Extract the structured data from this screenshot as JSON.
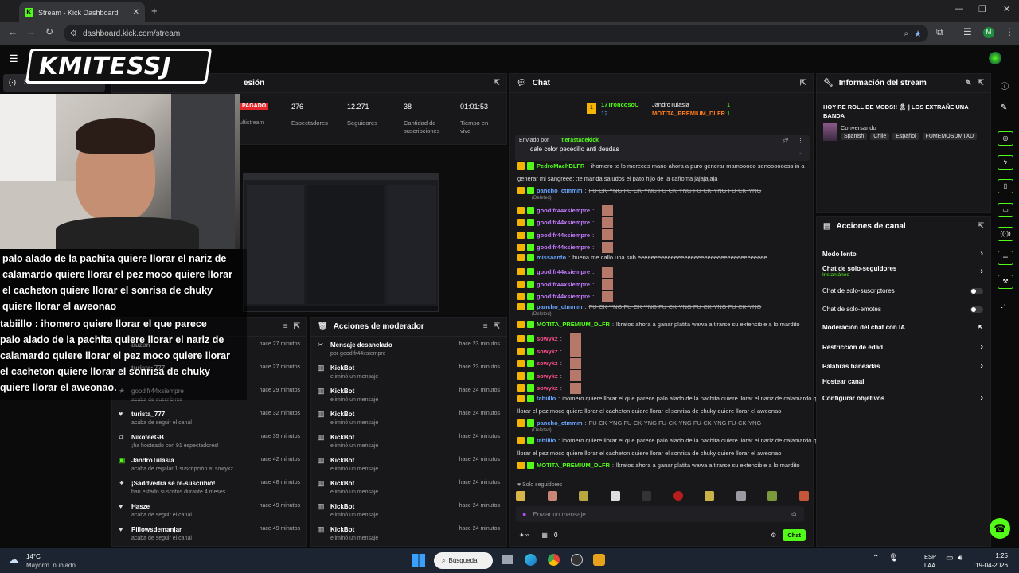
{
  "browser": {
    "tab_title": "Stream - Kick Dashboard",
    "url": "dashboard.kick.com/stream",
    "profile": "M"
  },
  "logo": "KMITESSJ",
  "session": {
    "title_partial": "esión",
    "tab_partial": "Str",
    "badge": "PAGADO",
    "multistream": "ultistream",
    "stats": [
      {
        "value": "276",
        "label": "Espectadores"
      },
      {
        "value": "12.271",
        "label": "Seguidores"
      },
      {
        "value": "38",
        "label": "Cantidad de suscripciones"
      },
      {
        "value": "01:01:53",
        "label": "Tiempo en vivo"
      }
    ]
  },
  "overlay_lines": [
    "palo alado de la pachita quiere llorar el nariz de",
    "calamardo quiere llorar el pez moco quiere llorar",
    "el cacheton quiere llorar el sonrisa de chuky",
    "quiere llorar el aweonao",
    "tabiillo : ihomero quiere llorar el que parece",
    "palo alado de la pachita quiere llorar el nariz de",
    "calamardo quiere llorar el pez moco quiere llorar",
    "el cacheton quiere llorar el sonrisa de chuky",
    "quiere llorar el aweonao."
  ],
  "activity": {
    "items": [
      {
        "name": "buzon",
        "desc": "",
        "time": "hace 27 minutos"
      },
      {
        "name": "turista_777",
        "desc": "",
        "time": "hace 27 minutos"
      },
      {
        "name": "goodlfr44xsiempre",
        "desc": "acaba de suscribirse",
        "time": "hace 29 minutos"
      },
      {
        "name": "turista_777",
        "desc": "acaba de seguir el canal",
        "time": "hace 32 minutos"
      },
      {
        "name": "NikoteeGB",
        "desc": "¡ha hosteado con 91 espectadores!",
        "time": "hace 35 minutos"
      },
      {
        "name": "JandroTulasia",
        "desc": "acaba de regalar 1 suscripción a: sowykz",
        "time": "hace 42 minutos"
      },
      {
        "name": "¡Saddvedra se re-suscribió!",
        "desc": "han estado suscritos durante 4 meses",
        "time": "hace 48 minutos"
      },
      {
        "name": "Hasze",
        "desc": "acaba de seguir el canal",
        "time": "hace 49 minutos"
      },
      {
        "name": "Pillowsdemanjar",
        "desc": "acaba de seguir el canal",
        "time": "hace 49 minutos"
      }
    ]
  },
  "mod": {
    "title": "Acciones de moderador",
    "items": [
      {
        "name": "Mensaje desanclado",
        "desc": "por goodlfr44xsiempre",
        "time": "hace 23 minutos"
      },
      {
        "name": "KickBot",
        "desc": "eliminó un mensaje",
        "time": "hace 23 minutos"
      },
      {
        "name": "KickBot",
        "desc": "eliminó un mensaje",
        "time": "hace 24 minutos"
      },
      {
        "name": "KickBot",
        "desc": "eliminó un mensaje",
        "time": "hace 24 minutos"
      },
      {
        "name": "KickBot",
        "desc": "eliminó un mensaje",
        "time": "hace 24 minutos"
      },
      {
        "name": "KickBot",
        "desc": "eliminó un mensaje",
        "time": "hace 24 minutos"
      },
      {
        "name": "KickBot",
        "desc": "eliminó un mensaje",
        "time": "hace 24 minutos"
      },
      {
        "name": "KickBot",
        "desc": "eliminó un mensaje",
        "time": "hace 24 minutos"
      },
      {
        "name": "KickBot",
        "desc": "eliminó un mensaje",
        "time": "hace 24 minutos"
      }
    ]
  },
  "chat": {
    "title": "Chat",
    "top_gifter_1": "17TroncosoC",
    "top_gifter_1_count": "12",
    "top_gifter_2": "JandroTulasia",
    "top_gifter_2_count": "1",
    "top_gifter_3": "MOTITA_PREMIUM_DLFR",
    "top_gifter_3_count": "1",
    "pinned_by_label": "Enviado por",
    "pinned_by": "tierastadekick",
    "pinned_text": "dale color pececillo anti deudas",
    "msgs": [
      {
        "user": "PedroMachDLFR",
        "text": "ihomero te lo mereces mano ahora a puro generar mamooooo senooooooss in a",
        "cls": "user-g"
      },
      {
        "user": "",
        "text": "generar mi sangreee: :te manda saludos el pato hijo de la cañoma jajajajaja",
        "cls": ""
      },
      {
        "user": "pancho_ctmmm",
        "text": "FU-CK-YNG  FU-CK-YNG  FU-CK-YNG  FU-CK-YNG  FU-CK-YNG",
        "cls": "user-b",
        "strike": true,
        "deleted": "(Deleted)"
      },
      {
        "user": "goodlfr44xsiempre",
        "text": "",
        "cls": "user-p"
      },
      {
        "user": "goodlfr44xsiempre",
        "text": "",
        "cls": "user-p"
      },
      {
        "user": "goodlfr44xsiempre",
        "text": "",
        "cls": "user-p"
      },
      {
        "user": "goodlfr44xsiempre",
        "text": "",
        "cls": "user-p"
      },
      {
        "user": "missaanto",
        "text": "buena me callo una sub eeeeeeeeeeeeeeeeeeeeeeeeeeeeeeeeeeeeeee",
        "cls": "user-b"
      },
      {
        "user": "goodlfr44xsiempre",
        "text": "",
        "cls": "user-p"
      },
      {
        "user": "goodlfr44xsiempre",
        "text": "",
        "cls": "user-p"
      },
      {
        "user": "goodlfr44xsiempre",
        "text": "",
        "cls": "user-p"
      },
      {
        "user": "pancho_ctmmm",
        "text": "FU-CK-YNG  FU-CK-YNG  FU-CK-YNG  FU-CK-YNG  FU-CK-YNG",
        "cls": "user-b",
        "strike": true,
        "deleted": "(Deleted)"
      },
      {
        "user": "MOTITA_PREMIUM_DLFR",
        "text": "lkratos ahora a ganar platita wawa a tirarse su extencible a lo mardito",
        "cls": "user-g"
      },
      {
        "user": "sowykz",
        "text": "",
        "cls": "user-r"
      },
      {
        "user": "sowykz",
        "text": "",
        "cls": "user-r"
      },
      {
        "user": "sowykz",
        "text": "",
        "cls": "user-r"
      },
      {
        "user": "sowykz",
        "text": "",
        "cls": "user-r"
      },
      {
        "user": "sowykz",
        "text": "",
        "cls": "user-r"
      },
      {
        "user": "tabiillo",
        "text": "ihomero quiere llorar el que parece palo alado de la pachita quiere llorar el nariz de calamardo quiere",
        "cls": "user-b"
      },
      {
        "user": "",
        "text": "llorar el pez moco quiere llorar el cacheton quiere llorar el sonrisa de chuky quiere llorar el aweonao",
        "cls": ""
      },
      {
        "user": "pancho_ctmmm",
        "text": "FU-CK-YNG  FU-CK-YNG  FU-CK-YNG  FU-CK-YNG  FU-CK-YNG",
        "cls": "user-b",
        "strike": true,
        "deleted": "(Deleted)"
      },
      {
        "user": "tabiillo",
        "text": "ihomero quiere llorar el que parece palo alado de la pachita quiere llorar el nariz de calamardo quiere",
        "cls": "user-b"
      },
      {
        "user": "",
        "text": "llorar el pez moco quiere llorar el cacheton quiere llorar el sonrisa de chuky quiere llorar el aweonao",
        "cls": ""
      },
      {
        "user": "MOTITA_PREMIUM_DLFR",
        "text": "lkratos ahora a ganar platita wawa a tirarse su extencible a lo mardito",
        "cls": "user-g"
      }
    ],
    "followers_only": "Solo seguidores",
    "input_placeholder": "Enviar un mensaje",
    "count": "0",
    "send": "Chat"
  },
  "info": {
    "title": "Información del stream",
    "stream_title": "HOY RE ROLL DE MODS!! 🎗 | LOS EXTRAÑE UNA BANDA",
    "category": "Conversando",
    "tags": [
      "Spanish",
      "Chile",
      "Español",
      "FUMEMOSDMTXD"
    ]
  },
  "actions": {
    "title": "Acciones de canal",
    "items": [
      {
        "label": "Modo lento",
        "sub": "",
        "ctrl": "chevron"
      },
      {
        "label": "Chat de solo-seguidores",
        "sub": "Instantáneo",
        "ctrl": "chevron"
      },
      {
        "label": "Chat de solo-suscriptores",
        "sub": "",
        "ctrl": "toggle"
      },
      {
        "label": "Chat de solo-emotes",
        "sub": "",
        "ctrl": "toggle"
      },
      {
        "label": "Moderación del chat con IA",
        "sub": "",
        "ctrl": "ext"
      },
      {
        "label": "Restricción de edad",
        "sub": "",
        "ctrl": "chevron"
      },
      {
        "label": "Palabras baneadas",
        "sub": "",
        "ctrl": "chevron"
      },
      {
        "label": "Hostear canal",
        "sub": "",
        "ctrl": ""
      },
      {
        "label": "Configurar objetivos",
        "sub": "",
        "ctrl": "chevron"
      }
    ]
  },
  "taskbar": {
    "temp": "14°C",
    "weather": "Mayorm. nublado",
    "search": "Búsqueda",
    "lang": "ESP",
    "lang2": "LAA",
    "time": "1:25",
    "date": "19-04-2026"
  }
}
